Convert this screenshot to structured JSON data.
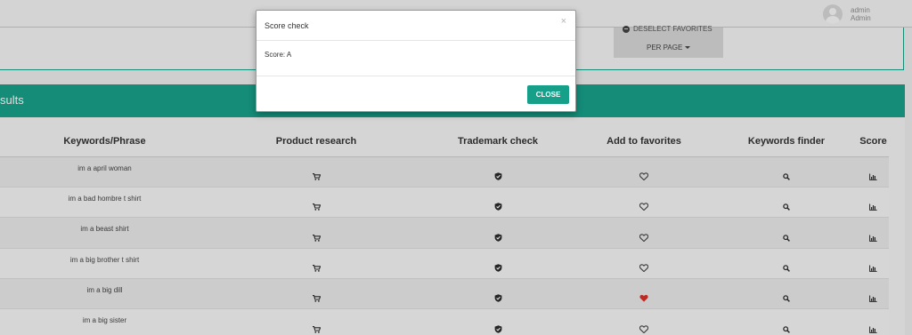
{
  "topbar": {
    "user_name": "admin",
    "user_role": "Admin"
  },
  "filters": {
    "deselect_favorites_label": "DESELECT FAVORITES",
    "per_page_label": "PER PAGE"
  },
  "results": {
    "title": "sults",
    "columns": [
      "Keywords/Phrase",
      "Product research",
      "Trademark check",
      "Add to favorites",
      "Keywords finder",
      "Score"
    ],
    "rows": [
      {
        "keyword": "im a april woman",
        "favorite": false
      },
      {
        "keyword": "im a bad hombre t shirt",
        "favorite": false
      },
      {
        "keyword": "im a beast shirt",
        "favorite": false
      },
      {
        "keyword": "im a big brother t shirt",
        "favorite": false
      },
      {
        "keyword": "im a big dill",
        "favorite": true
      },
      {
        "keyword": "im a big sister",
        "favorite": false
      }
    ]
  },
  "modal": {
    "title": "Score check",
    "close_x": "×",
    "body_text": "Score: A",
    "close_button_label": "CLOSE"
  },
  "colors": {
    "accent": "#17a089",
    "favorite_heart": "#d9312b"
  }
}
